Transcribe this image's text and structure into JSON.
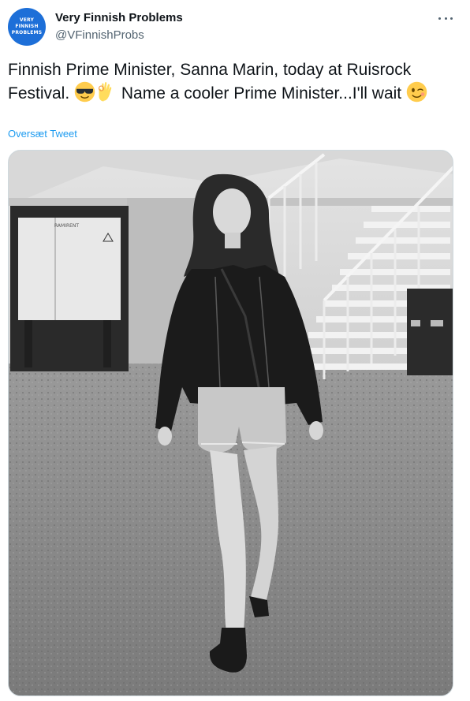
{
  "tweet": {
    "avatar": {
      "line1": "VERY",
      "line2": "FINNISH",
      "line3": "PROBLEMS"
    },
    "display_name": "Very Finnish Problems",
    "handle": "@VFinnishProbs",
    "text_part1": "Finnish Prime Minister, Sanna Marin, today at Ruisrock Festival. ",
    "text_part2": " Name a cooler Prime Minister...I'll wait ",
    "emojis": [
      "sunglasses-emoji",
      "ok-hand-emoji",
      "winking-face-emoji"
    ],
    "translate_label": "Oversæt Tweet",
    "media_sign_text": "RAMIRENT"
  },
  "colors": {
    "link": "#1d9bf0",
    "secondary_text": "#536471",
    "avatar_bg": "#1d6fd8"
  }
}
